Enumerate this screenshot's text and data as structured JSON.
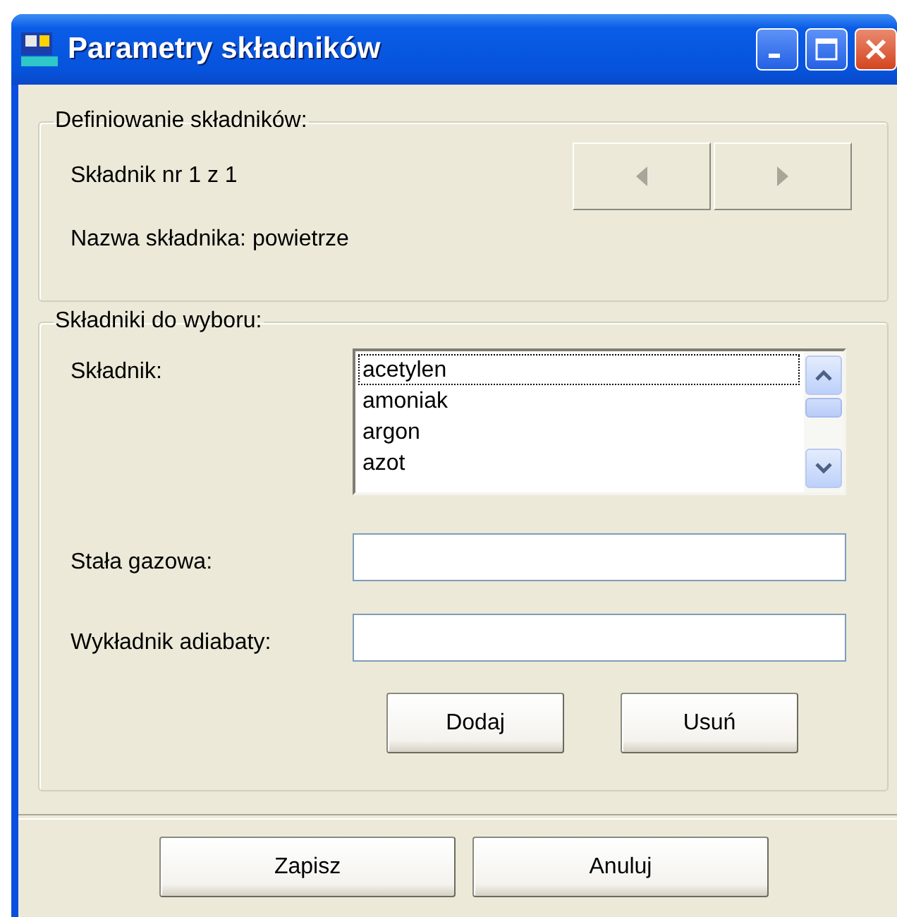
{
  "window": {
    "title": "Parametry składników"
  },
  "definition_group": {
    "legend": "Definiowanie składników:",
    "counter": "Składnik nr 1 z 1",
    "name_label": "Nazwa składnika: powietrze",
    "nav_buttons": [
      {
        "kind": "previous",
        "disabled": true
      },
      {
        "kind": "next",
        "disabled": true
      }
    ]
  },
  "selection_group": {
    "legend": "Składniki do wyboru:",
    "component_label": "Składnik:",
    "components": [
      {
        "label": "acetylen",
        "focused": true
      },
      {
        "label": "amoniak",
        "focused": false
      },
      {
        "label": "argon",
        "focused": false
      },
      {
        "label": "azot",
        "focused": false
      }
    ],
    "fields": [
      {
        "label": "Stała gazowa:"
      },
      {
        "label": "Wykładnik adiabaty:"
      }
    ],
    "buttons": [
      "Dodaj",
      "Usuń"
    ]
  },
  "footer_buttons": [
    "Zapisz",
    "Anuluj"
  ]
}
